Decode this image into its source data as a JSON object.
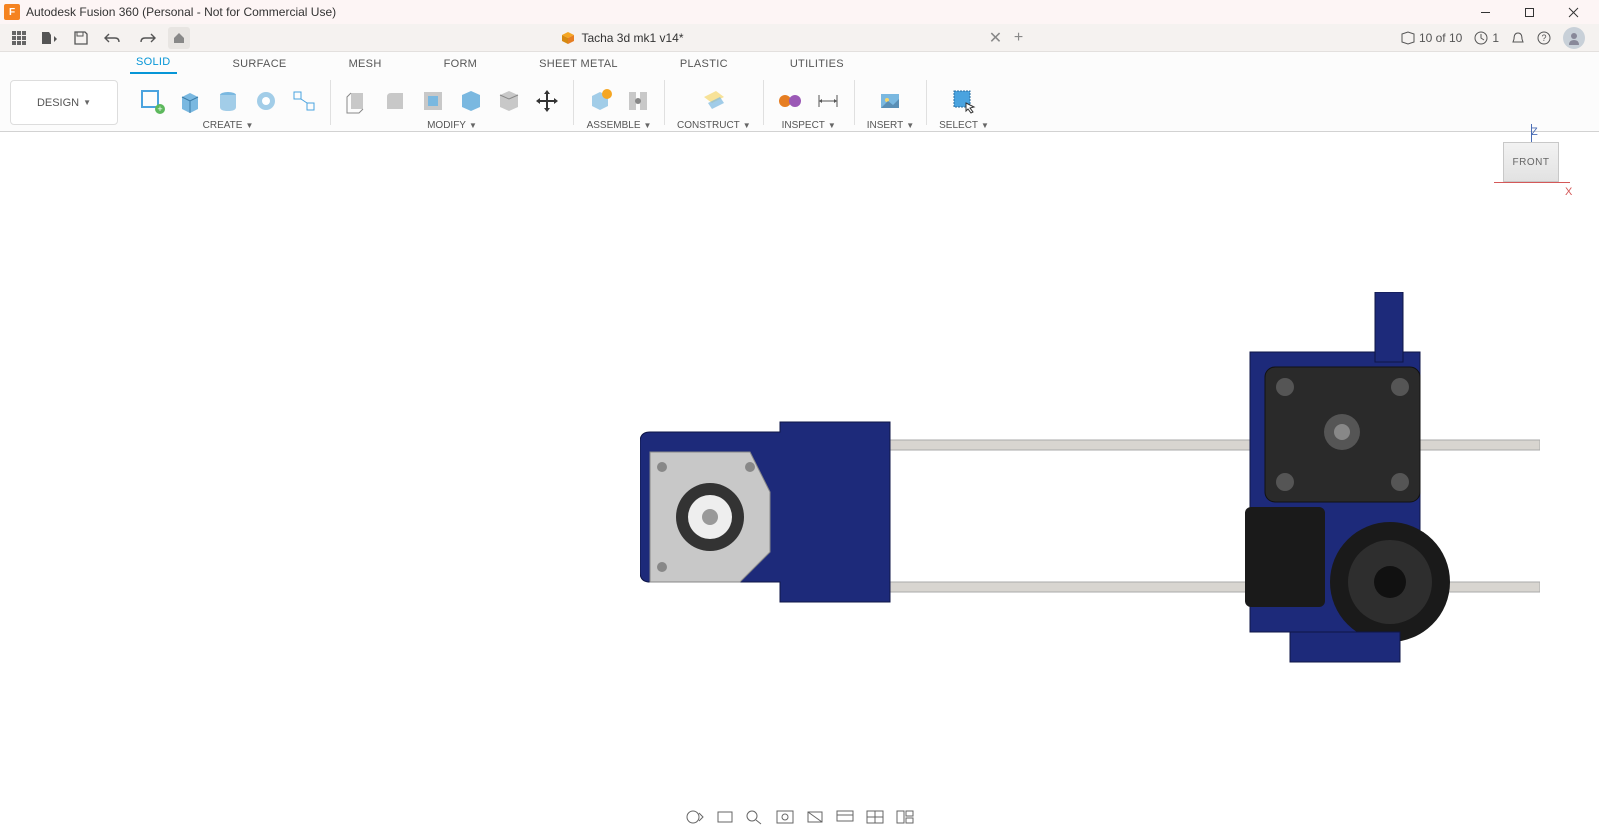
{
  "titlebar": {
    "app_title": "Autodesk Fusion 360 (Personal - Not for Commercial Use)",
    "app_icon_letter": "F"
  },
  "document": {
    "name": "Tacha 3d mk1 v14*"
  },
  "ribbon_tabs": [
    "SOLID",
    "SURFACE",
    "MESH",
    "FORM",
    "SHEET METAL",
    "PLASTIC",
    "UTILITIES"
  ],
  "active_tab": "SOLID",
  "workspace": "DESIGN",
  "groups": {
    "create": "CREATE",
    "modify": "MODIFY",
    "assemble": "ASSEMBLE",
    "construct": "CONSTRUCT",
    "inspect": "INSPECT",
    "insert": "INSERT",
    "select": "SELECT"
  },
  "status": {
    "save_count": "10 of 10",
    "jobs": "1"
  },
  "viewcube": {
    "face": "FRONT",
    "axis1": "Z",
    "axis2": "X"
  }
}
